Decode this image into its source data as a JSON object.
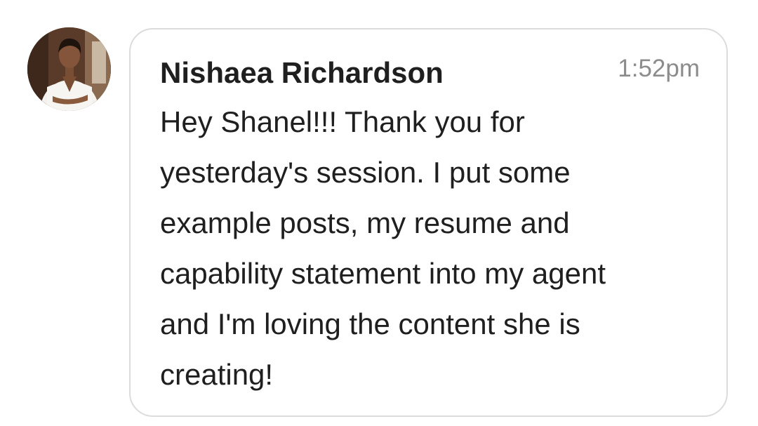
{
  "message": {
    "sender": "Nishaea Richardson",
    "time": "1:52pm",
    "text": "Hey Shanel!!! Thank you for\nyesterday's session. I put some\nexample posts, my resume and\ncapability statement into my agent\nand I'm loving the content she is\ncreating!",
    "avatar_icon": "profile-photo"
  },
  "colors": {
    "bubble_border": "#dcdcdc",
    "name_text": "#1f1f1f",
    "time_text": "#8c8c8c",
    "background": "#ffffff"
  }
}
